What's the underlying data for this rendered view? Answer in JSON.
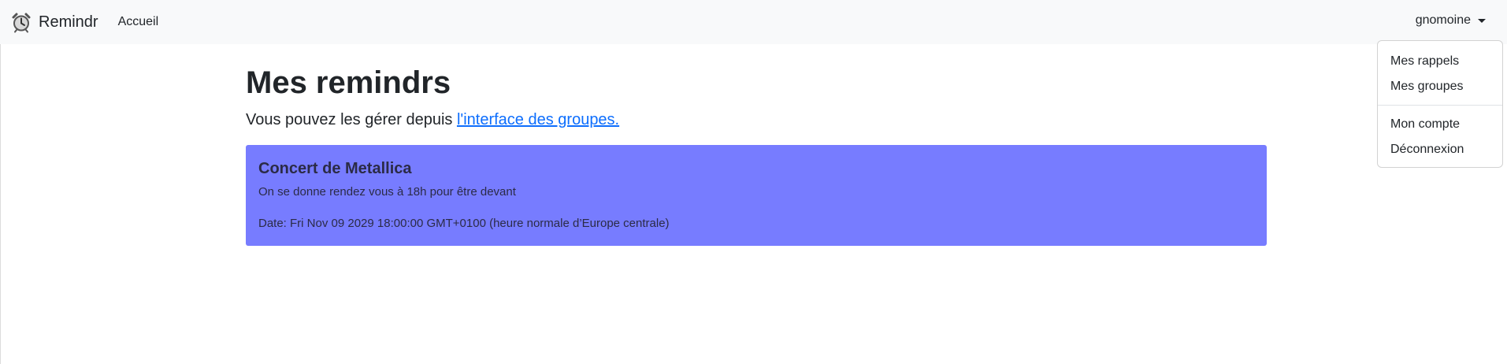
{
  "navbar": {
    "brand_label": "Remindr",
    "brand_icon": "alarm-clock-icon",
    "home_link": "Accueil",
    "username": "gnomoine"
  },
  "dropdown": {
    "items": [
      {
        "label": "Mes rappels"
      },
      {
        "label": "Mes groupes"
      },
      {
        "label": "Mon compte"
      },
      {
        "label": "Déconnexion"
      }
    ]
  },
  "main": {
    "title": "Mes remindrs",
    "subtitle_prefix": "Vous pouvez les gérer depuis ",
    "subtitle_link": "l'interface des groupes.",
    "reminders": [
      {
        "title": "Concert de Metallica",
        "description": "On se donne rendez vous à 18h pour être devant",
        "date": "Date: Fri Nov 09 2029 18:00:00 GMT+0100 (heure normale d’Europe centrale)",
        "color": "#777cff"
      }
    ]
  },
  "colors": {
    "navbar_bg": "#f8f9fa",
    "link": "#0d6efd",
    "text": "#212529"
  }
}
